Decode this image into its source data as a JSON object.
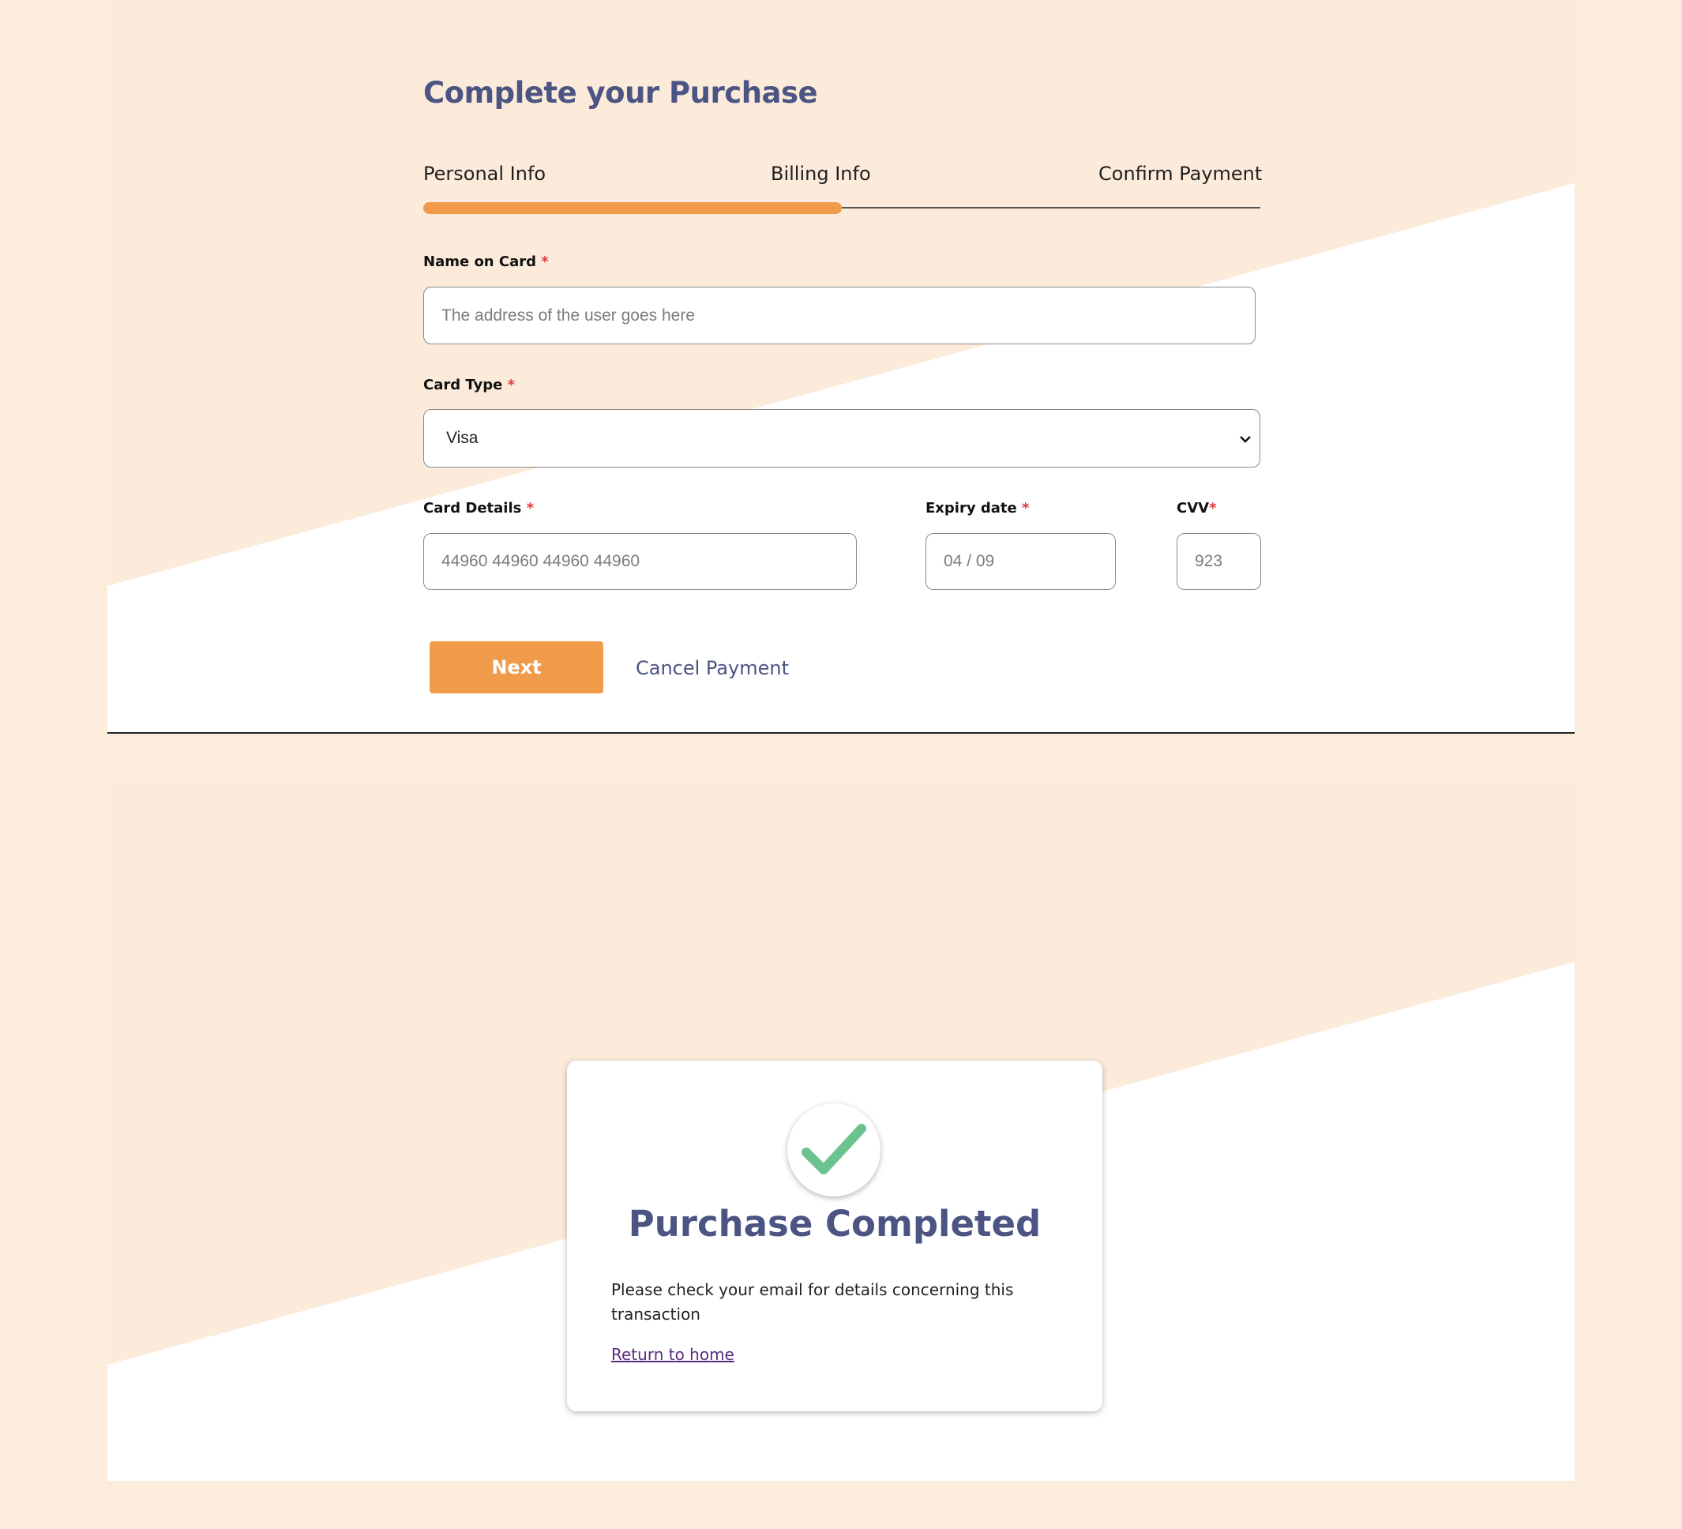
{
  "checkout": {
    "title": "Complete your Purchase",
    "steps": [
      {
        "label": "Personal Info"
      },
      {
        "label": "Billing Info"
      },
      {
        "label": "Confirm Payment"
      }
    ],
    "progress_percent": 50,
    "fields": {
      "name_on_card": {
        "label": "Name on Card",
        "required_mark": "*",
        "placeholder": "The address of the user goes here",
        "value": ""
      },
      "card_type": {
        "label": "Card Type",
        "required_mark": "*",
        "value": "Visa"
      },
      "card_details": {
        "label": "Card Details",
        "required_mark": "*",
        "placeholder": "44960 44960 44960 44960",
        "value": ""
      },
      "expiry_date": {
        "label": "Expiry date",
        "required_mark": "*",
        "placeholder": "04 / 09",
        "value": ""
      },
      "cvv": {
        "label": "CVV",
        "required_mark": "*",
        "placeholder": "923",
        "value": ""
      }
    },
    "next_label": "Next",
    "cancel_label": "Cancel Payment"
  },
  "confirmation": {
    "icon": "check-icon",
    "title": "Purchase Completed",
    "message": "Please check your email for details concerning this transaction",
    "link_label": "Return to home"
  },
  "colors": {
    "page_background": "#fcecdb",
    "accent": "#f09b4a",
    "heading": "#4b5483",
    "required": "#e23b3b",
    "success": "#6cc38f",
    "link": "#5a2d82"
  }
}
